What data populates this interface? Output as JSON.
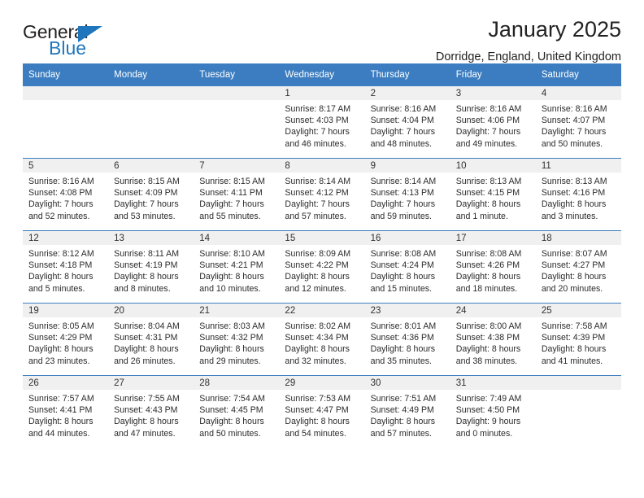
{
  "logo": {
    "primary_text": "General",
    "secondary_text": "Blue",
    "primary_color": "#231f20",
    "secondary_color": "#1f76bc"
  },
  "header": {
    "title": "January 2025",
    "subtitle": "Dorridge, England, United Kingdom"
  },
  "theme": {
    "header_blue": "#3b7dc0",
    "daynum_gray": "#f0f0f0",
    "text": "#2b2b2b"
  },
  "weekday_headers": [
    "Sunday",
    "Monday",
    "Tuesday",
    "Wednesday",
    "Thursday",
    "Friday",
    "Saturday"
  ],
  "weeks": [
    [
      {
        "day": "",
        "lines": []
      },
      {
        "day": "",
        "lines": []
      },
      {
        "day": "",
        "lines": []
      },
      {
        "day": "1",
        "lines": [
          "Sunrise: 8:17 AM",
          "Sunset: 4:03 PM",
          "Daylight: 7 hours",
          "and 46 minutes."
        ]
      },
      {
        "day": "2",
        "lines": [
          "Sunrise: 8:16 AM",
          "Sunset: 4:04 PM",
          "Daylight: 7 hours",
          "and 48 minutes."
        ]
      },
      {
        "day": "3",
        "lines": [
          "Sunrise: 8:16 AM",
          "Sunset: 4:06 PM",
          "Daylight: 7 hours",
          "and 49 minutes."
        ]
      },
      {
        "day": "4",
        "lines": [
          "Sunrise: 8:16 AM",
          "Sunset: 4:07 PM",
          "Daylight: 7 hours",
          "and 50 minutes."
        ]
      }
    ],
    [
      {
        "day": "5",
        "lines": [
          "Sunrise: 8:16 AM",
          "Sunset: 4:08 PM",
          "Daylight: 7 hours",
          "and 52 minutes."
        ]
      },
      {
        "day": "6",
        "lines": [
          "Sunrise: 8:15 AM",
          "Sunset: 4:09 PM",
          "Daylight: 7 hours",
          "and 53 minutes."
        ]
      },
      {
        "day": "7",
        "lines": [
          "Sunrise: 8:15 AM",
          "Sunset: 4:11 PM",
          "Daylight: 7 hours",
          "and 55 minutes."
        ]
      },
      {
        "day": "8",
        "lines": [
          "Sunrise: 8:14 AM",
          "Sunset: 4:12 PM",
          "Daylight: 7 hours",
          "and 57 minutes."
        ]
      },
      {
        "day": "9",
        "lines": [
          "Sunrise: 8:14 AM",
          "Sunset: 4:13 PM",
          "Daylight: 7 hours",
          "and 59 minutes."
        ]
      },
      {
        "day": "10",
        "lines": [
          "Sunrise: 8:13 AM",
          "Sunset: 4:15 PM",
          "Daylight: 8 hours",
          "and 1 minute."
        ]
      },
      {
        "day": "11",
        "lines": [
          "Sunrise: 8:13 AM",
          "Sunset: 4:16 PM",
          "Daylight: 8 hours",
          "and 3 minutes."
        ]
      }
    ],
    [
      {
        "day": "12",
        "lines": [
          "Sunrise: 8:12 AM",
          "Sunset: 4:18 PM",
          "Daylight: 8 hours",
          "and 5 minutes."
        ]
      },
      {
        "day": "13",
        "lines": [
          "Sunrise: 8:11 AM",
          "Sunset: 4:19 PM",
          "Daylight: 8 hours",
          "and 8 minutes."
        ]
      },
      {
        "day": "14",
        "lines": [
          "Sunrise: 8:10 AM",
          "Sunset: 4:21 PM",
          "Daylight: 8 hours",
          "and 10 minutes."
        ]
      },
      {
        "day": "15",
        "lines": [
          "Sunrise: 8:09 AM",
          "Sunset: 4:22 PM",
          "Daylight: 8 hours",
          "and 12 minutes."
        ]
      },
      {
        "day": "16",
        "lines": [
          "Sunrise: 8:08 AM",
          "Sunset: 4:24 PM",
          "Daylight: 8 hours",
          "and 15 minutes."
        ]
      },
      {
        "day": "17",
        "lines": [
          "Sunrise: 8:08 AM",
          "Sunset: 4:26 PM",
          "Daylight: 8 hours",
          "and 18 minutes."
        ]
      },
      {
        "day": "18",
        "lines": [
          "Sunrise: 8:07 AM",
          "Sunset: 4:27 PM",
          "Daylight: 8 hours",
          "and 20 minutes."
        ]
      }
    ],
    [
      {
        "day": "19",
        "lines": [
          "Sunrise: 8:05 AM",
          "Sunset: 4:29 PM",
          "Daylight: 8 hours",
          "and 23 minutes."
        ]
      },
      {
        "day": "20",
        "lines": [
          "Sunrise: 8:04 AM",
          "Sunset: 4:31 PM",
          "Daylight: 8 hours",
          "and 26 minutes."
        ]
      },
      {
        "day": "21",
        "lines": [
          "Sunrise: 8:03 AM",
          "Sunset: 4:32 PM",
          "Daylight: 8 hours",
          "and 29 minutes."
        ]
      },
      {
        "day": "22",
        "lines": [
          "Sunrise: 8:02 AM",
          "Sunset: 4:34 PM",
          "Daylight: 8 hours",
          "and 32 minutes."
        ]
      },
      {
        "day": "23",
        "lines": [
          "Sunrise: 8:01 AM",
          "Sunset: 4:36 PM",
          "Daylight: 8 hours",
          "and 35 minutes."
        ]
      },
      {
        "day": "24",
        "lines": [
          "Sunrise: 8:00 AM",
          "Sunset: 4:38 PM",
          "Daylight: 8 hours",
          "and 38 minutes."
        ]
      },
      {
        "day": "25",
        "lines": [
          "Sunrise: 7:58 AM",
          "Sunset: 4:39 PM",
          "Daylight: 8 hours",
          "and 41 minutes."
        ]
      }
    ],
    [
      {
        "day": "26",
        "lines": [
          "Sunrise: 7:57 AM",
          "Sunset: 4:41 PM",
          "Daylight: 8 hours",
          "and 44 minutes."
        ]
      },
      {
        "day": "27",
        "lines": [
          "Sunrise: 7:55 AM",
          "Sunset: 4:43 PM",
          "Daylight: 8 hours",
          "and 47 minutes."
        ]
      },
      {
        "day": "28",
        "lines": [
          "Sunrise: 7:54 AM",
          "Sunset: 4:45 PM",
          "Daylight: 8 hours",
          "and 50 minutes."
        ]
      },
      {
        "day": "29",
        "lines": [
          "Sunrise: 7:53 AM",
          "Sunset: 4:47 PM",
          "Daylight: 8 hours",
          "and 54 minutes."
        ]
      },
      {
        "day": "30",
        "lines": [
          "Sunrise: 7:51 AM",
          "Sunset: 4:49 PM",
          "Daylight: 8 hours",
          "and 57 minutes."
        ]
      },
      {
        "day": "31",
        "lines": [
          "Sunrise: 7:49 AM",
          "Sunset: 4:50 PM",
          "Daylight: 9 hours",
          "and 0 minutes."
        ]
      },
      {
        "day": "",
        "lines": []
      }
    ]
  ]
}
